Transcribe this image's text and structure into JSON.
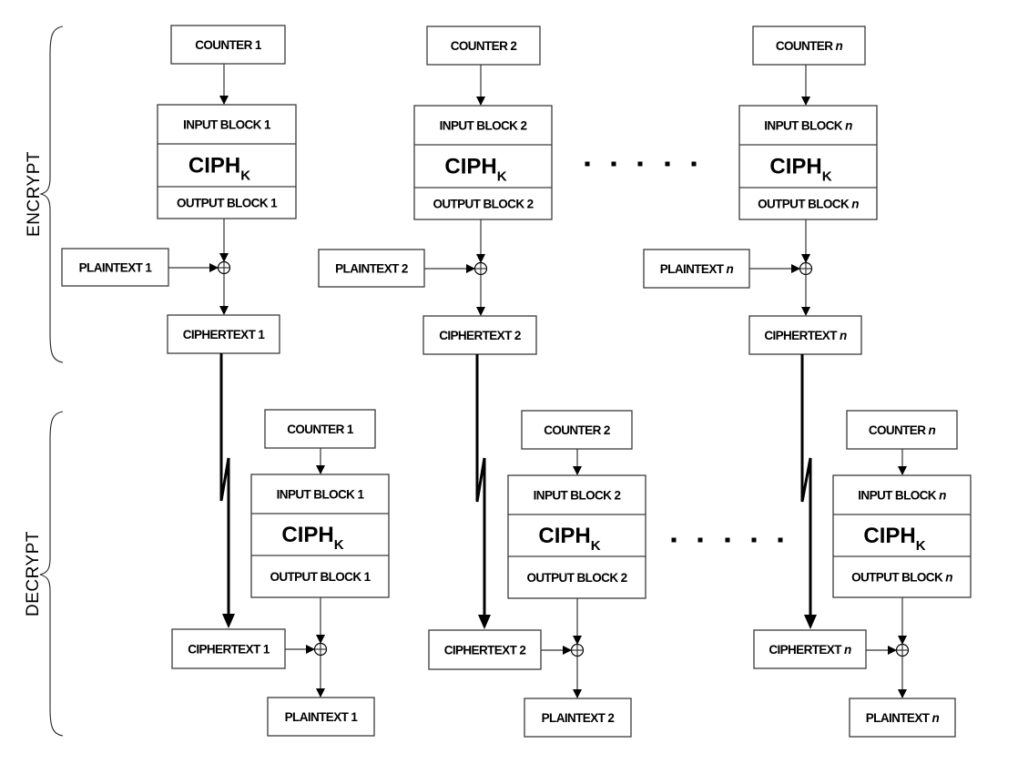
{
  "sections": {
    "encrypt": "ENCRYPT",
    "decrypt": "DECRYPT"
  },
  "cipher": {
    "main": "CIPH",
    "subscript": "K"
  },
  "encrypt_columns": [
    {
      "index": "1",
      "italic": false,
      "counter": "COUNTER",
      "input_block": "INPUT BLOCK",
      "output_block": "OUTPUT BLOCK",
      "plaintext": "PLAINTEXT",
      "ciphertext": "CIPHERTEXT"
    },
    {
      "index": "2",
      "italic": false,
      "counter": "COUNTER",
      "input_block": "INPUT BLOCK",
      "output_block": "OUTPUT BLOCK",
      "plaintext": "PLAINTEXT",
      "ciphertext": "CIPHERTEXT"
    },
    {
      "index": "n",
      "italic": true,
      "counter": "COUNTER",
      "input_block": "INPUT BLOCK",
      "output_block": "OUTPUT BLOCK",
      "plaintext": "PLAINTEXT",
      "ciphertext": "CIPHERTEXT"
    }
  ],
  "decrypt_columns": [
    {
      "index": "1",
      "italic": false,
      "counter": "COUNTER",
      "input_block": "INPUT BLOCK",
      "output_block": "OUTPUT BLOCK",
      "plaintext": "PLAINTEXT",
      "ciphertext": "CIPHERTEXT"
    },
    {
      "index": "2",
      "italic": false,
      "counter": "COUNTER",
      "input_block": "INPUT BLOCK",
      "output_block": "OUTPUT BLOCK",
      "plaintext": "PLAINTEXT",
      "ciphertext": "CIPHERTEXT"
    },
    {
      "index": "n",
      "italic": true,
      "counter": "COUNTER",
      "input_block": "INPUT BLOCK",
      "output_block": "OUTPUT BLOCK",
      "plaintext": "PLAINTEXT",
      "ciphertext": "CIPHERTEXT"
    }
  ],
  "xor_symbol": "⊕",
  "ellipsis_dot_count": 5
}
